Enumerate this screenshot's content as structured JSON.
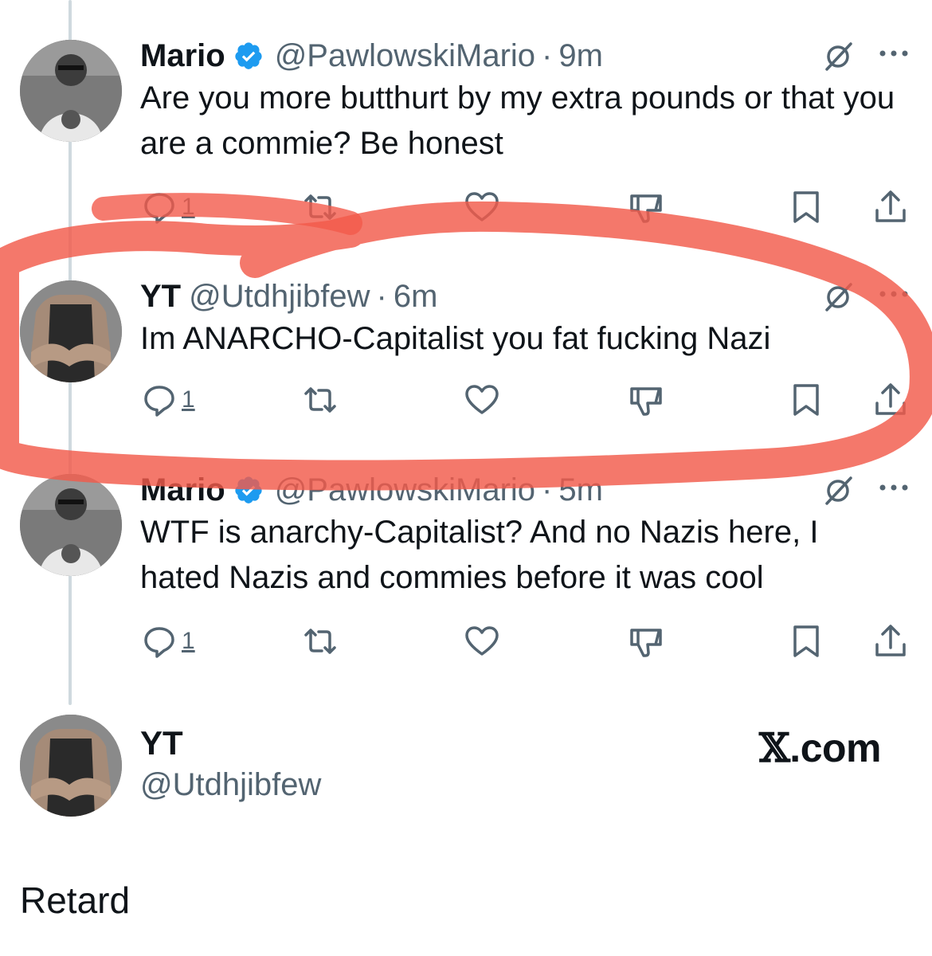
{
  "colors": {
    "text": "#0f1419",
    "muted": "#536471",
    "verified": "#1d9bf0",
    "thread_line": "#cfd9de",
    "highlight_marker": "#f25a4b"
  },
  "tweets": [
    {
      "name": "Mario",
      "verified": true,
      "handle": "@PawlowskiMario",
      "separator": "·",
      "time": "9m",
      "text": "Are you more butthurt by my extra pounds or that you are a commie? Be honest",
      "reply_count": "1",
      "icons": [
        "grok-icon",
        "more-icon",
        "reply-icon",
        "retweet-icon",
        "like-icon",
        "dislike-icon",
        "bookmark-icon",
        "share-icon"
      ]
    },
    {
      "name": "YT",
      "verified": false,
      "handle": "@Utdhjibfew",
      "separator": "·",
      "time": "6m",
      "text": "Im ANARCHO-Capitalist you fat fucking Nazi",
      "reply_count": "1",
      "highlighted": true
    },
    {
      "name": "Mario",
      "verified": true,
      "handle": "@PawlowskiMario",
      "separator": "·",
      "time": "5m",
      "text": "WTF is anarchy-Capitalist? And no Nazis here, I hated Nazis and commies before it was cool",
      "reply_count": "1"
    }
  ],
  "user_card": {
    "name": "YT",
    "handle": "@Utdhjibfew",
    "brand_x": "𝕏",
    "brand_suffix": ".com"
  },
  "reply_text": "Retard"
}
